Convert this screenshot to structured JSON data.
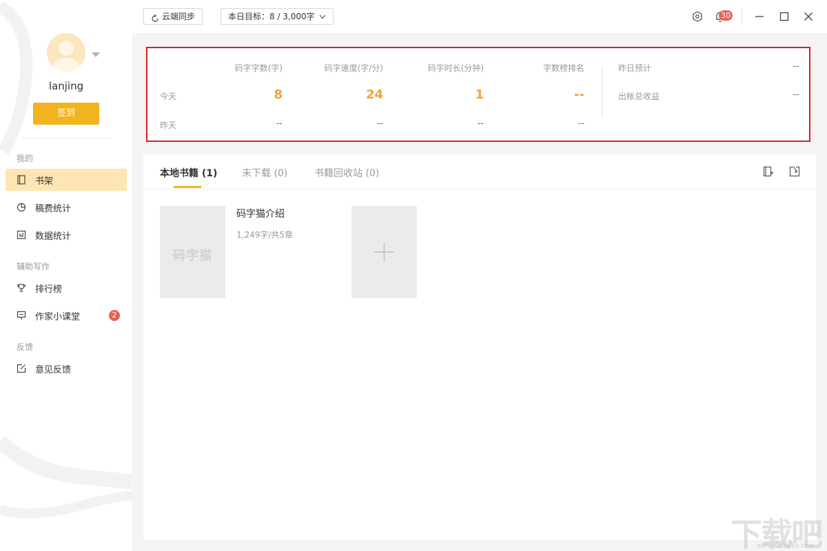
{
  "sidebar": {
    "username": "lanjing",
    "signin_label": "签到",
    "sections": [
      {
        "label": "我的"
      },
      {
        "label": "辅助写作"
      },
      {
        "label": "反馈"
      }
    ],
    "items": [
      {
        "label": "书架",
        "icon": "book-icon",
        "active": true
      },
      {
        "label": "稿费统计",
        "icon": "pie-chart-icon"
      },
      {
        "label": "数据统计",
        "icon": "bar-chart-icon"
      },
      {
        "label": "排行榜",
        "icon": "trophy-icon"
      },
      {
        "label": "作家小课堂",
        "icon": "classroom-icon",
        "badge": "2"
      },
      {
        "label": "意见反馈",
        "icon": "edit-icon"
      }
    ]
  },
  "topbar": {
    "sync_label": "云端同步",
    "goal_label": "本日目标：8 / 3,000字",
    "notification_count": "30"
  },
  "stats": {
    "columns": [
      "码字字数(字)",
      "码字速度(字/分)",
      "码字时长(分钟)",
      "字数榜排名"
    ],
    "row_today": "今天",
    "row_yesterday": "昨天",
    "today": [
      "8",
      "24",
      "1",
      "--"
    ],
    "yesterday": [
      "--",
      "--",
      "--",
      "--"
    ],
    "side": [
      {
        "label": "昨日预计",
        "value": "--"
      },
      {
        "label": "出帐总收益",
        "value": "--"
      }
    ]
  },
  "shelf": {
    "tabs": [
      {
        "label": "本地书籍 (1)",
        "active": true
      },
      {
        "label": "未下载 (0)"
      },
      {
        "label": "书籍回收站 (0)"
      }
    ],
    "books": [
      {
        "title": "码字猫介绍",
        "meta": "1,249字/共5章",
        "cover_text": "码字猫"
      }
    ]
  },
  "watermark": {
    "text": "下载吧",
    "sub": "www.xiazaiba.com"
  },
  "colors": {
    "accent": "#f0b41e",
    "highlight": "#d81e20",
    "value": "#f0a232",
    "badge": "#e36357"
  }
}
